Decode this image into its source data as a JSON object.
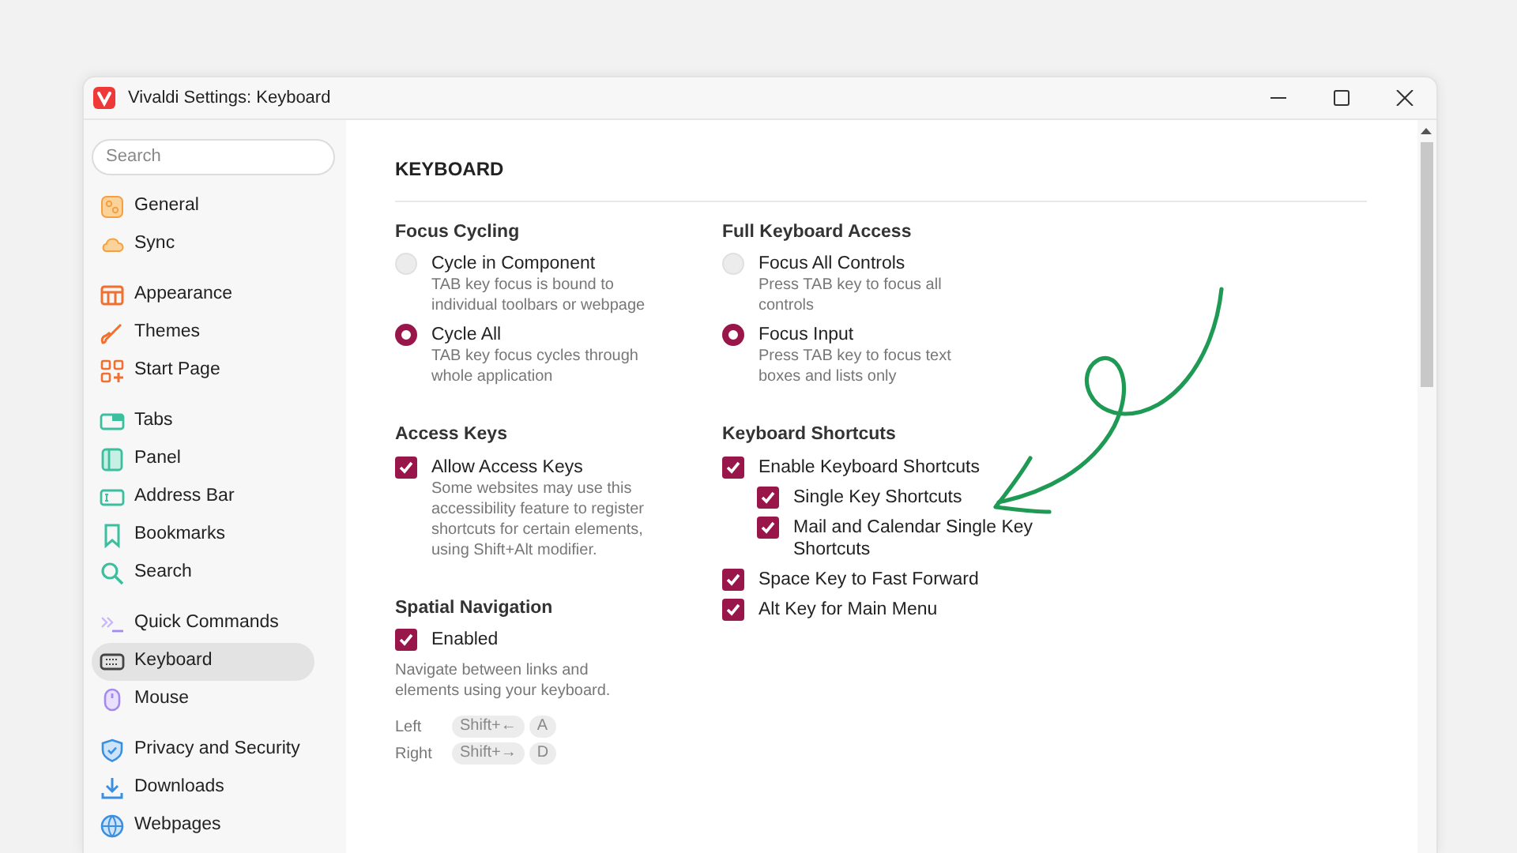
{
  "window": {
    "title": "Vivaldi Settings: Keyboard"
  },
  "sidebar": {
    "search": {
      "placeholder": "Search"
    },
    "groups": [
      [
        {
          "label": "General",
          "selected": false
        },
        {
          "label": "Sync",
          "selected": false
        }
      ],
      [
        {
          "label": "Appearance",
          "selected": false
        },
        {
          "label": "Themes",
          "selected": false
        },
        {
          "label": "Start Page",
          "selected": false
        }
      ],
      [
        {
          "label": "Tabs",
          "selected": false
        },
        {
          "label": "Panel",
          "selected": false
        },
        {
          "label": "Address Bar",
          "selected": false
        },
        {
          "label": "Bookmarks",
          "selected": false
        },
        {
          "label": "Search",
          "selected": false
        }
      ],
      [
        {
          "label": "Quick Commands",
          "selected": false
        },
        {
          "label": "Keyboard",
          "selected": true
        },
        {
          "label": "Mouse",
          "selected": false
        }
      ],
      [
        {
          "label": "Privacy and Security",
          "selected": false
        },
        {
          "label": "Downloads",
          "selected": false
        },
        {
          "label": "Webpages",
          "selected": false
        }
      ]
    ]
  },
  "content": {
    "heading": "KEYBOARD",
    "columns": [
      [
        {
          "title": "Focus Cycling",
          "options": [
            {
              "kind": "radio",
              "label": "Cycle in Component",
              "description": "TAB key focus is bound to individual toolbars or webpage",
              "selected": false
            },
            {
              "kind": "radio",
              "label": "Cycle All",
              "description": "TAB key focus cycles through whole application",
              "selected": true
            }
          ]
        },
        {
          "title": "Access Keys",
          "options": [
            {
              "kind": "checkbox",
              "label": "Allow Access Keys",
              "description": "Some websites may use this accessibility feature to register shortcuts for certain elements, using Shift+Alt modifier.",
              "checked": true
            }
          ]
        },
        {
          "title": "Spatial Navigation",
          "options": [
            {
              "kind": "checkbox",
              "label": "Enabled",
              "checked": true
            }
          ],
          "note": "Navigate between links and elements using your keyboard.",
          "shortcuts": [
            {
              "label": "Left",
              "keys": [
                "Shift+←",
                "A"
              ]
            },
            {
              "label": "Right",
              "keys": [
                "Shift+→",
                "D"
              ]
            }
          ]
        }
      ],
      [
        {
          "title": "Full Keyboard Access",
          "options": [
            {
              "kind": "radio",
              "label": "Focus All Controls",
              "description": "Press TAB key to focus all controls",
              "selected": false
            },
            {
              "kind": "radio",
              "label": "Focus Input",
              "description": "Press TAB key to focus text boxes and lists only",
              "selected": true
            }
          ]
        },
        {
          "title": "Keyboard Shortcuts",
          "options": [
            {
              "kind": "checkbox",
              "label": "Enable Keyboard Shortcuts",
              "checked": true,
              "children": [
                {
                  "kind": "checkbox",
                  "label": "Single Key Shortcuts",
                  "checked": true
                },
                {
                  "kind": "checkbox",
                  "label": "Mail and Calendar Single Key Shortcuts",
                  "checked": true
                }
              ]
            },
            {
              "kind": "checkbox",
              "label": "Space Key to Fast Forward",
              "checked": true
            },
            {
              "kind": "checkbox",
              "label": "Alt Key for Main Menu",
              "checked": true
            }
          ]
        }
      ]
    ]
  }
}
